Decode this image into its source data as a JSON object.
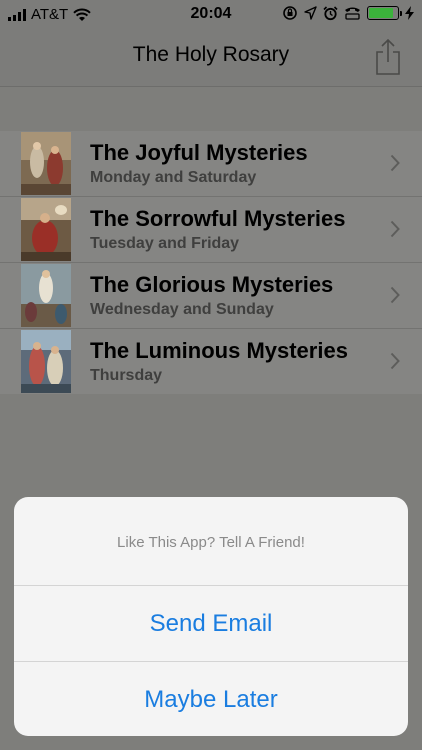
{
  "status_bar": {
    "carrier": "AT&T",
    "time": "20:04",
    "battery_level": 0.9
  },
  "nav": {
    "title": "The Holy Rosary",
    "share_icon": "share-icon"
  },
  "mysteries": [
    {
      "title": "The Joyful Mysteries",
      "days": "Monday and Saturday"
    },
    {
      "title": "The Sorrowful Mysteries",
      "days": "Tuesday and Friday"
    },
    {
      "title": "The Glorious Mysteries",
      "days": "Wednesday and Sunday"
    },
    {
      "title": "The Luminous Mysteries",
      "days": "Thursday"
    }
  ],
  "alert": {
    "message": "Like This App? Tell A Friend!",
    "send_email": "Send Email",
    "maybe_later": "Maybe Later"
  },
  "colors": {
    "accent": "#1a7de0",
    "battery": "#3bb23b"
  }
}
